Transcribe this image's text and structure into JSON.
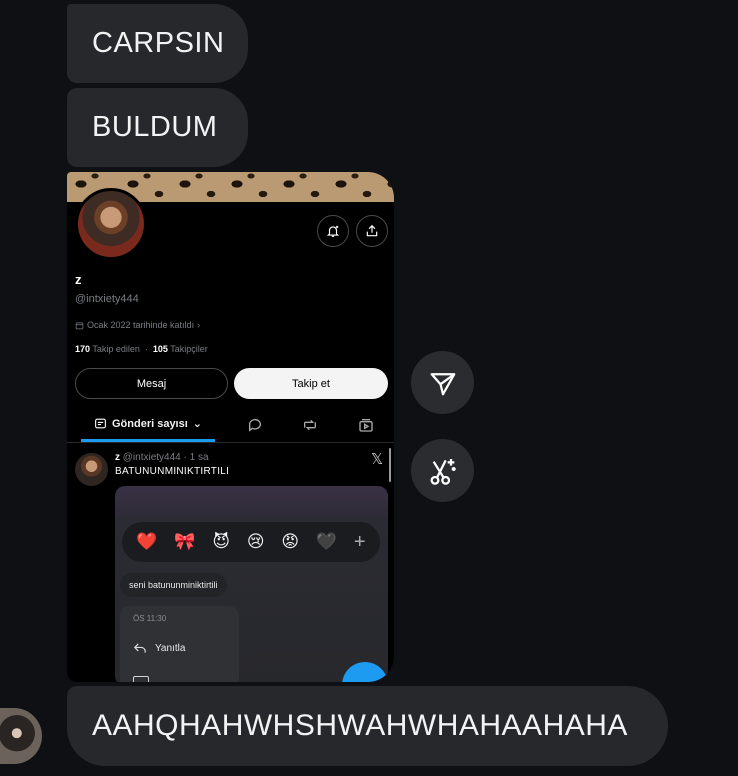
{
  "messages": [
    {
      "text": "CARPSIN"
    },
    {
      "text": "BULDUM"
    },
    {
      "text": "AAHQHAHWHSHWAHWHAHAAHAHA"
    }
  ],
  "shared_screenshot": {
    "profile": {
      "display_name": "z",
      "handle": "@intxiety444",
      "joined": "Ocak 2022 tarihinde katıldı",
      "following_count": "170",
      "following_label": "Takip edilen",
      "followers_count": "105",
      "followers_label": "Takipçiler",
      "message_button": "Mesaj",
      "follow_button": "Takip et"
    },
    "tabs": {
      "posts_label": "Gönderi sayısı"
    },
    "tweet": {
      "author": "z",
      "meta": "@intxiety444 · 1 sa",
      "text": "BATUNUNMINIKTIRTILI",
      "x_logo": "𝕏",
      "embedded": {
        "reactions": [
          "❤️",
          "🎀",
          "😈",
          "😢",
          "😡",
          "🖤",
          "+"
        ],
        "quoted_message": "seni batununminiktirtili",
        "menu_time": "ÖS 11:30",
        "menu_reply": "Yanıtla"
      }
    }
  },
  "icons": {
    "forward": "paper-plane-icon",
    "remix": "scissors-sparkle-icon"
  },
  "colors": {
    "background": "#0f1013",
    "bubble": "#26282c",
    "accent_blue": "#1d9bf0"
  }
}
